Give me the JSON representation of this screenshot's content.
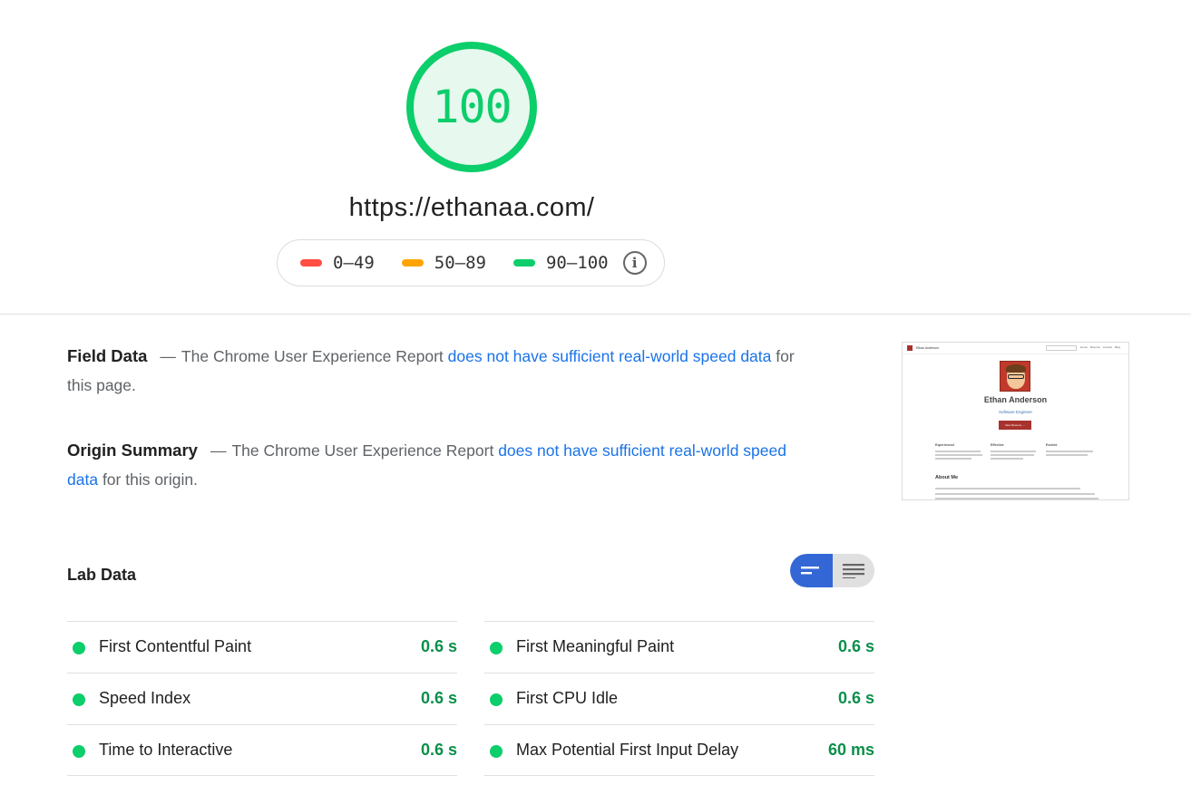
{
  "score": {
    "value": "100",
    "ring_color": "#0cce6b",
    "fill_color": "#e7f8ee",
    "percent": 100
  },
  "url": "https://ethanaa.com/",
  "legend": {
    "items": [
      {
        "label": "0–49",
        "color": "#ff4e42"
      },
      {
        "label": "50–89",
        "color": "#ffa400"
      },
      {
        "label": "90–100",
        "color": "#0cce6b"
      }
    ],
    "info_icon": "info-icon"
  },
  "field_data": {
    "heading": "Field Data",
    "dash": "—",
    "pre": "The Chrome User Experience Report",
    "link": "does not have sufficient real-world speed data",
    "post": "for this page."
  },
  "origin_summary": {
    "heading": "Origin Summary",
    "dash": "—",
    "pre": "The Chrome User Experience Report",
    "link": "does not have sufficient real-world speed data",
    "post": "for this origin."
  },
  "thumbnail": {
    "site_title": "Ethan Anderson",
    "nav_links": "Home Resume Contact Blog",
    "name": "Ethan Anderson",
    "role": "Software Engineer",
    "button": "View Resume →",
    "columns": [
      "Experienced",
      "Effective",
      "Excited"
    ],
    "about_heading": "About Me"
  },
  "lab_data": {
    "title": "Lab Data",
    "toggle": {
      "active": "summary-view",
      "icons": [
        "summary-view-icon",
        "list-view-icon"
      ]
    },
    "metrics_left": [
      {
        "label": "First Contentful Paint",
        "value": "0.6 s"
      },
      {
        "label": "Speed Index",
        "value": "0.6 s"
      },
      {
        "label": "Time to Interactive",
        "value": "0.6 s"
      }
    ],
    "metrics_right": [
      {
        "label": "First Meaningful Paint",
        "value": "0.6 s"
      },
      {
        "label": "First CPU Idle",
        "value": "0.6 s"
      },
      {
        "label": "Max Potential First Input Delay",
        "value": "60 ms"
      }
    ],
    "status_color": "#0cce6b",
    "value_color": "#0a8f4a"
  }
}
